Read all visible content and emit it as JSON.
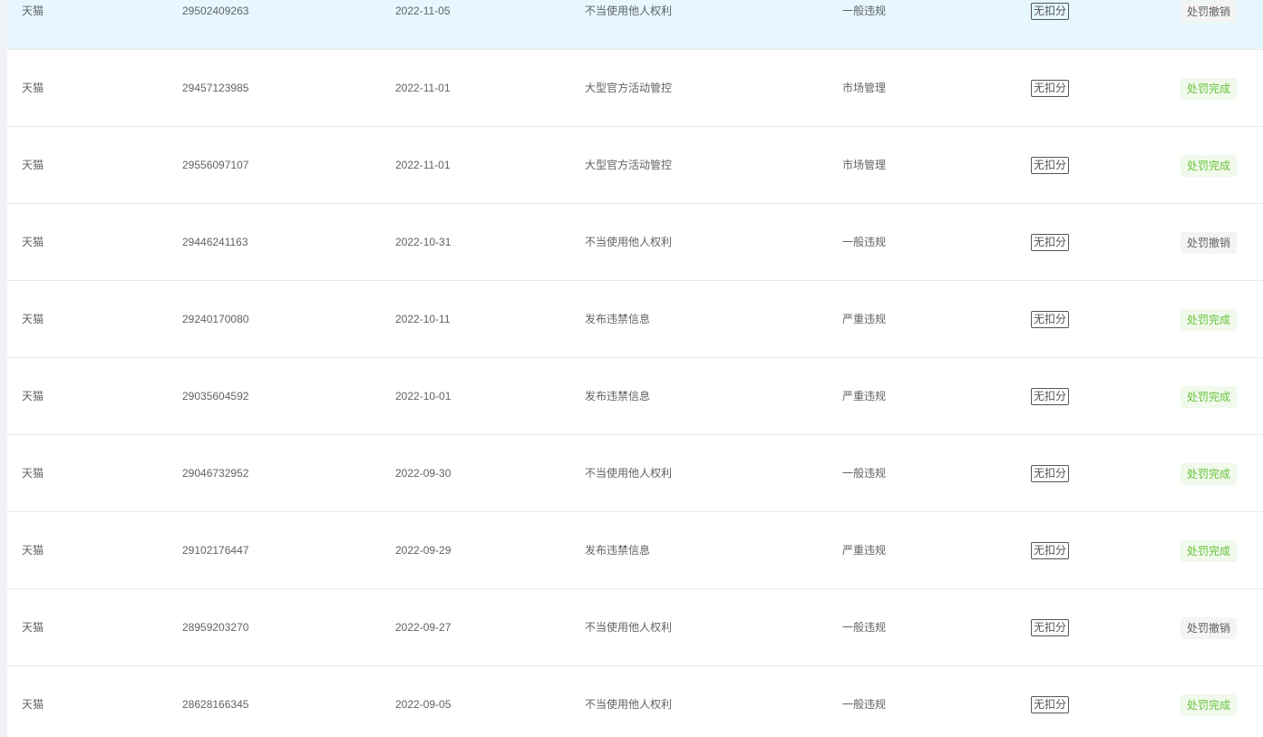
{
  "table": {
    "rows": [
      {
        "platform": "天猫",
        "id": "29502409263",
        "date": "2022-11-05",
        "reason": "不当使用他人权利",
        "type": "一般违规",
        "score": "无扣分",
        "status": "处罚撤销",
        "status_kind": "revoked"
      },
      {
        "platform": "天猫",
        "id": "29457123985",
        "date": "2022-11-01",
        "reason": "大型官方活动管控",
        "type": "市场管理",
        "score": "无扣分",
        "status": "处罚完成",
        "status_kind": "done"
      },
      {
        "platform": "天猫",
        "id": "29556097107",
        "date": "2022-11-01",
        "reason": "大型官方活动管控",
        "type": "市场管理",
        "score": "无扣分",
        "status": "处罚完成",
        "status_kind": "done"
      },
      {
        "platform": "天猫",
        "id": "29446241163",
        "date": "2022-10-31",
        "reason": "不当使用他人权利",
        "type": "一般违规",
        "score": "无扣分",
        "status": "处罚撤销",
        "status_kind": "revoked"
      },
      {
        "platform": "天猫",
        "id": "29240170080",
        "date": "2022-10-11",
        "reason": "发布违禁信息",
        "type": "严重违规",
        "score": "无扣分",
        "status": "处罚完成",
        "status_kind": "done"
      },
      {
        "platform": "天猫",
        "id": "29035604592",
        "date": "2022-10-01",
        "reason": "发布违禁信息",
        "type": "严重违规",
        "score": "无扣分",
        "status": "处罚完成",
        "status_kind": "done"
      },
      {
        "platform": "天猫",
        "id": "29046732952",
        "date": "2022-09-30",
        "reason": "不当使用他人权利",
        "type": "一般违规",
        "score": "无扣分",
        "status": "处罚完成",
        "status_kind": "done"
      },
      {
        "platform": "天猫",
        "id": "29102176447",
        "date": "2022-09-29",
        "reason": "发布违禁信息",
        "type": "严重违规",
        "score": "无扣分",
        "status": "处罚完成",
        "status_kind": "done"
      },
      {
        "platform": "天猫",
        "id": "28959203270",
        "date": "2022-09-27",
        "reason": "不当使用他人权利",
        "type": "一般违规",
        "score": "无扣分",
        "status": "处罚撤销",
        "status_kind": "revoked"
      },
      {
        "platform": "天猫",
        "id": "28628166345",
        "date": "2022-09-05",
        "reason": "不当使用他人权利",
        "type": "一般违规",
        "score": "无扣分",
        "status": "处罚完成",
        "status_kind": "done"
      }
    ],
    "hovered_row": 0
  },
  "colors": {
    "hover_row_bg": "#e6f7ff",
    "status_done_text": "#67c23a",
    "status_done_bg": "#f0f9eb",
    "status_revoked_text": "#606266",
    "status_revoked_bg": "#f4f4f5"
  }
}
